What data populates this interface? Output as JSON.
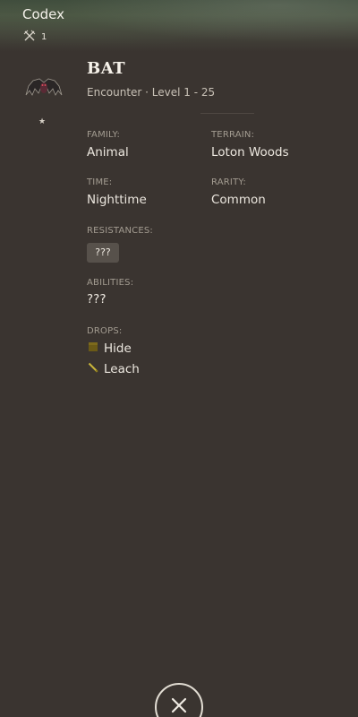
{
  "header": {
    "title": "Codex",
    "count": "1"
  },
  "entry": {
    "name": "BAT",
    "subtitle": "Encounter · Level 1 - 25",
    "family_label": "FAMILY:",
    "family": "Animal",
    "terrain_label": "TERRAIN:",
    "terrain": "Loton Woods",
    "time_label": "TIME:",
    "time": "Nighttime",
    "rarity_label": "RARITY:",
    "rarity": "Common",
    "resistances_label": "RESISTANCES:",
    "resistances": "???",
    "abilities_label": "ABILITIES:",
    "abilities": "???",
    "drops_label": "DROPS:",
    "drops": [
      {
        "name": "Hide",
        "icon": "hide-item-icon"
      },
      {
        "name": "Leach",
        "icon": "leach-item-icon"
      }
    ],
    "stars": "★"
  },
  "colors": {
    "background": "#3a3430",
    "label": "#a39c91",
    "text": "#ece7df"
  }
}
